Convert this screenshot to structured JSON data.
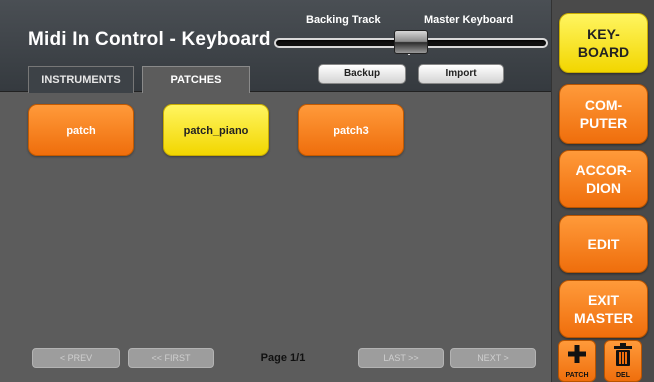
{
  "header": {
    "title": "Midi In Control - Keyboard",
    "crossfader": {
      "left_label": "Backing Track",
      "right_label": "Master Keyboard",
      "position": 0.5
    },
    "backup_label": "Backup",
    "import_label": "Import"
  },
  "tabs": [
    {
      "label": "INSTRUMENTS",
      "active": false
    },
    {
      "label": "PATCHES",
      "active": true
    }
  ],
  "patches": [
    {
      "label": "patch",
      "selected": false
    },
    {
      "label": "patch_piano",
      "selected": true
    },
    {
      "label": "patch3",
      "selected": false
    }
  ],
  "pager": {
    "prev_label": "< PREV",
    "first_label": "<< FIRST",
    "page_label": "Page 1/1",
    "last_label": "LAST >>",
    "next_label": "NEXT >"
  },
  "sidebar": {
    "keyboard_label": "KEY-\nBOARD",
    "computer_label": "COM-\nPUTER",
    "accordion_label": "ACCOR-\nDION",
    "edit_label": "EDIT",
    "exit_master_label": "EXIT\nMASTER",
    "patch_add_label": "PATCH",
    "delete_label": "DEL"
  },
  "colors": {
    "accent_orange": "#f58220",
    "selected_yellow": "#f7e21b",
    "background": "#5c5c5c",
    "header": "#3f444a"
  },
  "icons": {
    "patch_add": "plus-icon",
    "delete": "trash-icon"
  }
}
